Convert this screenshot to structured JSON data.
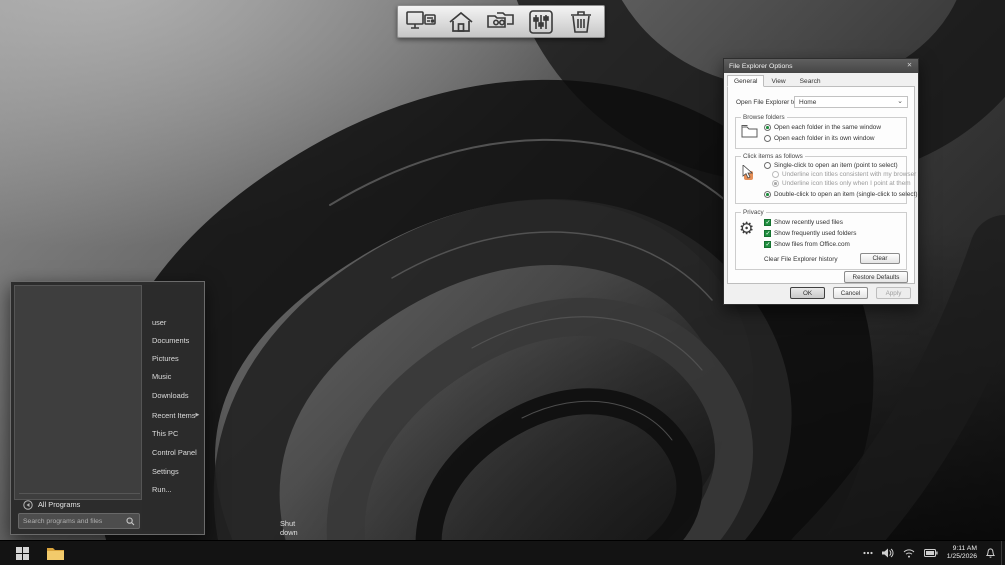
{
  "accent": "#1e8e3e",
  "desktop_toolbar": {
    "icons": [
      "computer",
      "home",
      "shared-folders",
      "mixer",
      "recycle-bin"
    ]
  },
  "dialog": {
    "title": "File Explorer Options",
    "close_glyph": "✕",
    "tabs": [
      "General",
      "View",
      "Search"
    ],
    "open_to": {
      "label": "Open File Explorer to:",
      "value": "Home",
      "chevron": "⌄"
    },
    "browse_folders": {
      "legend": "Browse folders",
      "option_same": "Open each folder in the same window",
      "option_own": "Open each folder in its own window"
    },
    "click_items": {
      "legend": "Click items as follows",
      "single": "Single-click to open an item (point to select)",
      "underline_browser": "Underline icon titles consistent with my browser",
      "underline_point": "Underline icon titles only when I point at them",
      "double": "Double-click to open an item (single-click to select)"
    },
    "privacy": {
      "legend": "Privacy",
      "check_recent": "Show recently used files",
      "check_frequent": "Show frequently used folders",
      "check_office": "Show files from Office.com",
      "clear_label": "Clear File Explorer history",
      "clear_button": "Clear"
    },
    "restore_defaults": "Restore Defaults",
    "ok": "OK",
    "cancel": "Cancel",
    "apply": "Apply"
  },
  "start_menu": {
    "items": [
      "user",
      "Documents",
      "Pictures",
      "Music",
      "Downloads",
      "Recent Items",
      "This PC",
      "Control Panel",
      "Settings",
      "Run..."
    ],
    "submenu_arrow": "▶",
    "all_programs": "All Programs",
    "search_placeholder": "Search programs and files",
    "shut_down": "Shut down"
  },
  "taskbar": {
    "time": "9:11 AM",
    "date": "1/25/2026"
  }
}
